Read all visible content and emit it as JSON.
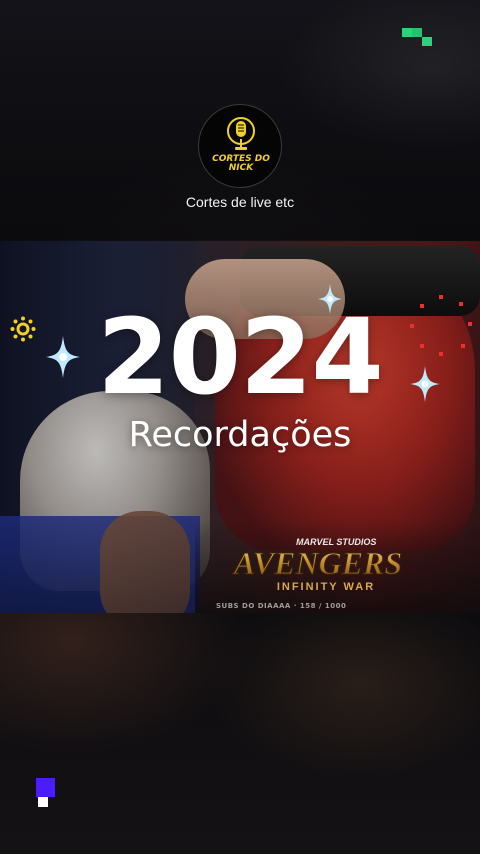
{
  "channel": {
    "avatar_line1": "CORTES DO",
    "avatar_line2": "NICK",
    "name": "Cortes de live etc"
  },
  "headline": {
    "year": "2024",
    "subtitle": "Recordações"
  },
  "video": {
    "brand_small": "MARVEL STUDIOS",
    "logo_text": "AVENGERS",
    "logo_sub": "INFINITY WAR",
    "credit": "SUBS DO DIAAAA · 158 / 1000"
  },
  "colors": {
    "accent_yellow": "#f1cf2a",
    "accent_green": "#2bd37a",
    "accent_purple": "#4b1cff",
    "accent_red": "#e8322b",
    "sparkle_blue": "#bfe9ff"
  },
  "icons": {
    "top_right": "pixel-blocks-icon",
    "bottom_left": "pixel-squares-icon",
    "left_sun": "sun-icon",
    "right_ring": "dotted-ring-icon",
    "sparkles": "sparkle-icon"
  }
}
